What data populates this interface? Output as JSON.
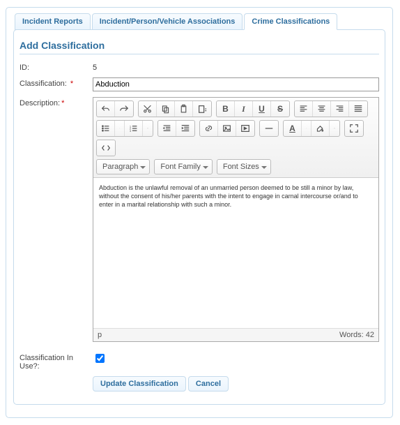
{
  "tabs": [
    "Incident Reports",
    "Incident/Person/Vehicle Associations",
    "Crime Classifications"
  ],
  "panel": {
    "title": "Add Classification"
  },
  "form": {
    "id": {
      "label": "ID:",
      "value": "5"
    },
    "classification": {
      "label": "Classification: ",
      "value": "Abduction"
    },
    "description": {
      "label": "Description:",
      "value": "Abduction is the unlawful removal of an unmarried person deemed to be still a minor by law, without the consent of his/her parents with the intent to engage in carnal intercourse or/and to enter in a marital relationship with such a minor."
    },
    "in_use": {
      "label": "Classification In Use?:",
      "checked": true
    }
  },
  "editor": {
    "selects": [
      "Paragraph",
      "Font Family",
      "Font Sizes"
    ],
    "status_path": "p",
    "words_label": "Words:",
    "word_count": 42
  },
  "buttons": {
    "update": "Update Classification",
    "cancel": "Cancel"
  }
}
